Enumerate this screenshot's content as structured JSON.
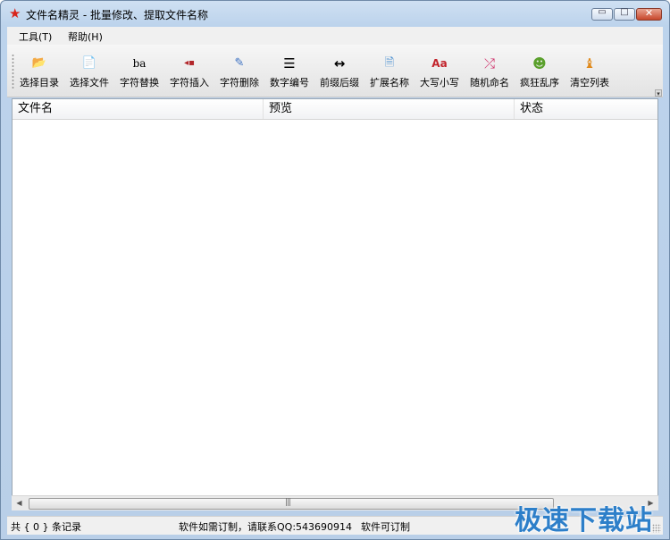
{
  "window": {
    "title": "文件名精灵 - 批量修改、提取文件名称",
    "app_icon": "red-star-icon",
    "controls": {
      "minimize": "▭",
      "maximize": "□",
      "close": "✕"
    }
  },
  "menu": [
    {
      "label": "工具(T)"
    },
    {
      "label": "帮助(H)"
    }
  ],
  "toolbar": [
    {
      "label": "选择目录",
      "icon": "folder-open-icon",
      "glyph": "📂"
    },
    {
      "label": "选择文件",
      "icon": "file-icon",
      "glyph": "📄"
    },
    {
      "label": "字符替换",
      "icon": "replace-text-icon",
      "glyph": "ba"
    },
    {
      "label": "字符插入",
      "icon": "insert-text-icon",
      "glyph": "◂▪"
    },
    {
      "label": "字符删除",
      "icon": "eraser-icon",
      "glyph": "✎"
    },
    {
      "label": "数字编号",
      "icon": "numbered-list-icon",
      "glyph": "☰"
    },
    {
      "label": "前缀后缀",
      "icon": "arrows-left-right-icon",
      "glyph": "↔"
    },
    {
      "label": "扩展名称",
      "icon": "extension-file-icon",
      "glyph": "🗎"
    },
    {
      "label": "大写小写",
      "icon": "case-icon",
      "glyph": "Aa"
    },
    {
      "label": "随机命名",
      "icon": "shuffle-icon",
      "glyph": "⤮"
    },
    {
      "label": "疯狂乱序",
      "icon": "frog-icon",
      "glyph": "☻"
    },
    {
      "label": "清空列表",
      "icon": "clear-list-icon",
      "glyph": "♝"
    }
  ],
  "table": {
    "columns": [
      {
        "label": "文件名"
      },
      {
        "label": "预览"
      },
      {
        "label": "状态"
      }
    ],
    "rows": []
  },
  "status": {
    "records": "共 { 0 } 条记录",
    "contact": "软件如需订制，请联系QQ:543690914",
    "custom": "软件可订制"
  },
  "watermark": "极速下载站",
  "colors": {
    "title_icon": "#d8231b",
    "watermark": "#2d7fc9"
  }
}
